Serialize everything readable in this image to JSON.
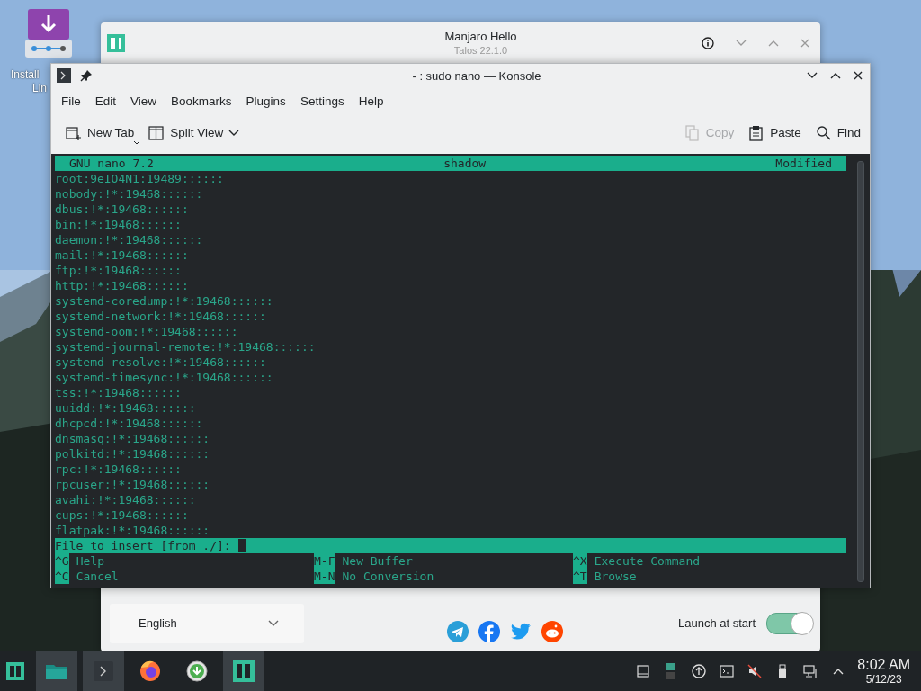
{
  "desktop": {
    "icons": [
      {
        "label_lines": [
          "Install",
          "Lin"
        ]
      }
    ]
  },
  "hello_window": {
    "title": "Manjaro Hello",
    "subtitle": "Talos 22.1.0",
    "language": "English",
    "launch": {
      "label": "Launch at start",
      "on": true
    }
  },
  "konsole": {
    "title": "- : sudo nano — Konsole",
    "menu": [
      "File",
      "Edit",
      "View",
      "Bookmarks",
      "Plugins",
      "Settings",
      "Help"
    ],
    "toolbar": [
      {
        "kind": "newtab",
        "label": "New Tab",
        "disabled": false
      },
      {
        "kind": "split",
        "label": "Split View",
        "disabled": false
      },
      {
        "kind": "copy",
        "label": "Copy",
        "disabled": true
      },
      {
        "kind": "paste",
        "label": "Paste",
        "disabled": false
      },
      {
        "kind": "find",
        "label": "Find",
        "disabled": false
      }
    ],
    "nano": {
      "version": "GNU nano 7.2",
      "filename": "shadow",
      "status": "Modified",
      "lines": [
        "root:9eIO4N1:19489::::::",
        "nobody:!*:19468::::::",
        "dbus:!*:19468::::::",
        "bin:!*:19468::::::",
        "daemon:!*:19468::::::",
        "mail:!*:19468::::::",
        "ftp:!*:19468::::::",
        "http:!*:19468::::::",
        "systemd-coredump:!*:19468::::::",
        "systemd-network:!*:19468::::::",
        "systemd-oom:!*:19468::::::",
        "systemd-journal-remote:!*:19468::::::",
        "systemd-resolve:!*:19468::::::",
        "systemd-timesync:!*:19468::::::",
        "tss:!*:19468::::::",
        "uuidd:!*:19468::::::",
        "dhcpcd:!*:19468::::::",
        "dnsmasq:!*:19468::::::",
        "polkitd:!*:19468::::::",
        "rpc:!*:19468::::::",
        "rpcuser:!*:19468::::::",
        "avahi:!*:19468::::::",
        "cups:!*:19468::::::",
        "flatpak:!*:19468::::::"
      ],
      "prompt": "File to insert [from ./]: ",
      "shortcuts": [
        {
          "key": "^G",
          "label": "Help"
        },
        {
          "key": "M-F",
          "label": "New Buffer"
        },
        {
          "key": "^X",
          "label": "Execute Command"
        },
        {
          "key": "^C",
          "label": "Cancel"
        },
        {
          "key": "M-N",
          "label": "No Conversion"
        },
        {
          "key": "^T",
          "label": "Browse"
        }
      ]
    }
  },
  "taskbar": {
    "tasks": [
      {
        "kind": "launcher",
        "active": false
      },
      {
        "kind": "files",
        "active": true
      },
      {
        "kind": "terminal",
        "active": true
      },
      {
        "kind": "firefox",
        "active": false
      },
      {
        "kind": "download",
        "active": false
      },
      {
        "kind": "hello",
        "active": true
      }
    ],
    "clock": {
      "time": "8:02 AM",
      "date": "5/12/23"
    }
  }
}
